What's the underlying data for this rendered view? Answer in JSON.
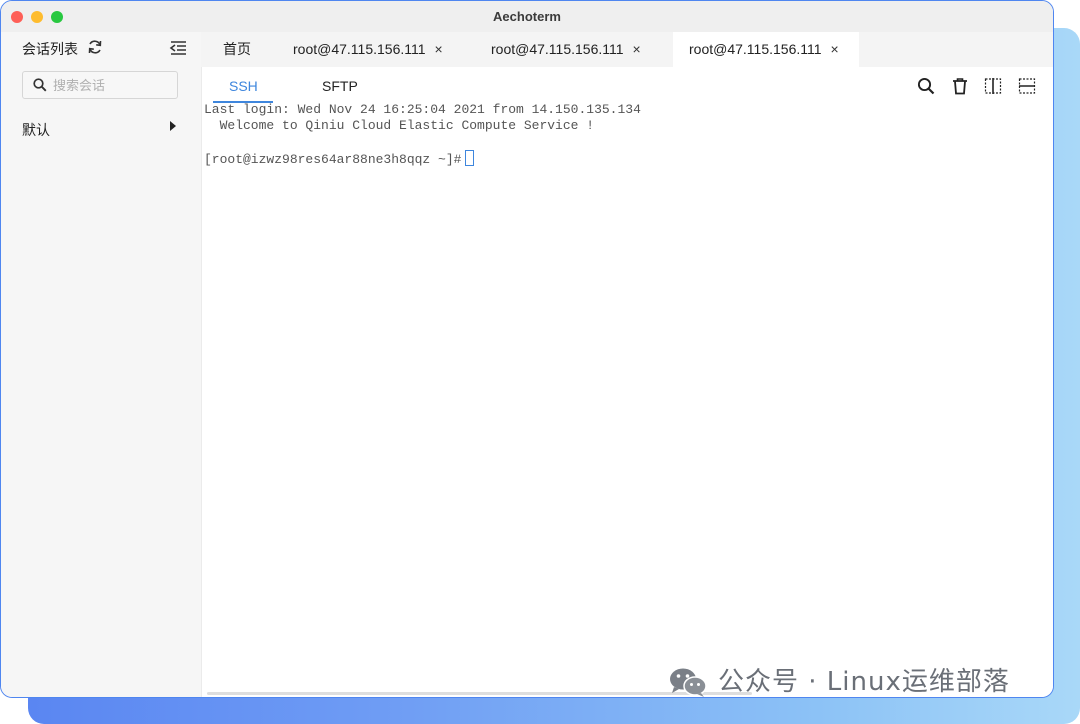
{
  "app": {
    "title": "Aechoterm"
  },
  "sidebar": {
    "header_label": "会话列表",
    "search_placeholder": "搜索会话",
    "groups": [
      {
        "label": "默认"
      }
    ]
  },
  "tabs": {
    "home_label": "首页",
    "sessions": [
      {
        "label": "root@47.115.156.111",
        "active": false
      },
      {
        "label": "root@47.115.156.111",
        "active": false
      },
      {
        "label": "root@47.115.156.111",
        "active": true
      }
    ],
    "close_glyph": "×"
  },
  "subtabs": {
    "ssh": "SSH",
    "sftp": "SFTP",
    "active": "SSH"
  },
  "terminal": {
    "line1": "Last login: Wed Nov 24 16:25:04 2021 from 14.150.135.134",
    "line2": "  Welcome to Qiniu Cloud Elastic Compute Service !",
    "prompt": "[root@izwz98res64ar88ne3h8qqz ~]#"
  },
  "watermark": {
    "text": "公众号 · Linux运维部落"
  },
  "colors": {
    "accent": "#3e86dd",
    "window_border": "#4f86f0"
  }
}
